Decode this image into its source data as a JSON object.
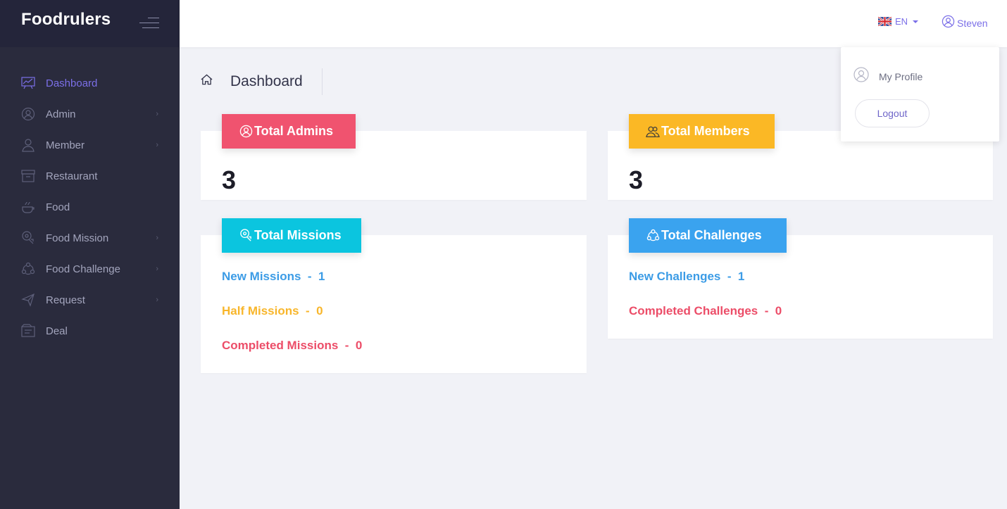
{
  "sidebar": {
    "brand": "Foodrulers",
    "items": [
      {
        "label": "Dashboard",
        "icon": "dashboard-icon",
        "active": true,
        "has_children": false
      },
      {
        "label": "Admin",
        "icon": "admin-icon",
        "active": false,
        "has_children": true
      },
      {
        "label": "Member",
        "icon": "member-icon",
        "active": false,
        "has_children": true
      },
      {
        "label": "Restaurant",
        "icon": "restaurant-icon",
        "active": false,
        "has_children": false
      },
      {
        "label": "Food",
        "icon": "food-icon",
        "active": false,
        "has_children": false
      },
      {
        "label": "Food Mission",
        "icon": "food-mission-icon",
        "active": false,
        "has_children": true
      },
      {
        "label": "Food Challenge",
        "icon": "food-challenge-icon",
        "active": false,
        "has_children": true
      },
      {
        "label": "Request",
        "icon": "request-icon",
        "active": false,
        "has_children": true
      },
      {
        "label": "Deal",
        "icon": "deal-icon",
        "active": false,
        "has_children": false
      }
    ]
  },
  "header": {
    "language": "EN",
    "language_flag": "uk-flag-icon",
    "user_name": "Steven"
  },
  "dropdown": {
    "profile_label": "My Profile",
    "logout_label": "Logout"
  },
  "breadcrumb": {
    "title": "Dashboard"
  },
  "cards": {
    "admins": {
      "title": "Total Admins",
      "value": "3",
      "color": "#f0536f"
    },
    "members": {
      "title": "Total Members",
      "value": "3",
      "color": "#fbb825"
    },
    "missions": {
      "title": "Total Missions",
      "color": "#0bc5df",
      "new": "New Missions  -  1",
      "half": "Half Missions  -  0",
      "completed": "Completed Missions  -  0"
    },
    "challenges": {
      "title": "Total Challenges",
      "color": "#3aa3ef",
      "new": "New Challenges  -  1",
      "completed": "Completed Challenges  -  0"
    }
  },
  "colors": {
    "sidebar_bg": "#2a2b3d",
    "accent": "#7b6fe8",
    "page_bg": "#f1f2f7"
  }
}
